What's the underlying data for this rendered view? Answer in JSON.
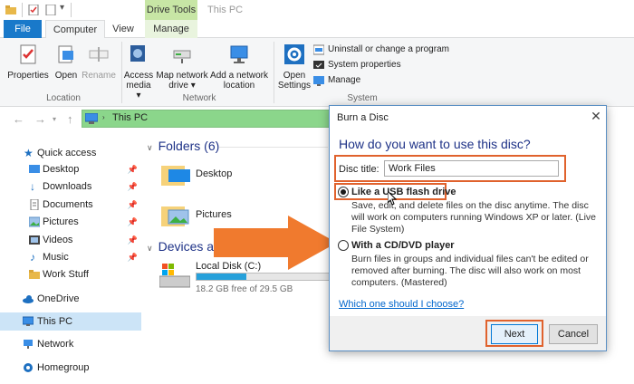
{
  "window": {
    "title": "This PC",
    "context_tab": "Drive Tools"
  },
  "tabs": {
    "file": "File",
    "computer": "Computer",
    "view": "View",
    "manage": "Manage"
  },
  "ribbon": {
    "location": {
      "label": "Location",
      "properties": "Properties",
      "open": "Open",
      "rename": "Rename"
    },
    "network": {
      "label": "Network",
      "access_media": "Access media ▾",
      "map_drive": "Map network drive ▾",
      "add_location": "Add a network location"
    },
    "system": {
      "label": "System",
      "open_settings": "Open Settings",
      "uninstall": "Uninstall or change a program",
      "system_properties": "System properties",
      "manage": "Manage"
    }
  },
  "address": {
    "path": "This PC"
  },
  "nav": {
    "quick_access": "Quick access",
    "desktop": "Desktop",
    "downloads": "Downloads",
    "documents": "Documents",
    "pictures": "Pictures",
    "videos": "Videos",
    "music": "Music",
    "work_stuff": "Work Stuff",
    "onedrive": "OneDrive",
    "this_pc": "This PC",
    "network": "Network",
    "homegroup": "Homegroup"
  },
  "content": {
    "folders_header": "Folders (6)",
    "folders": [
      "Desktop",
      "Pictures"
    ],
    "devices_header": "Devices and",
    "drive": {
      "name": "Local Disk (C:)",
      "free": "18.2 GB free of 29.5 GB",
      "used_fraction": 0.38
    }
  },
  "dialog": {
    "title": "Burn a Disc",
    "close": "✕",
    "question": "How do you want to use this disc?",
    "disc_title_label": "Disc title:",
    "disc_title_value": "Work Files",
    "option1": {
      "title": "Like a USB flash drive",
      "desc": "Save, edit, and delete files on the disc anytime. The disc will work on computers running Windows XP or later. (Live File System)",
      "selected": true
    },
    "option2": {
      "title": "With a CD/DVD player",
      "desc": "Burn files in groups and individual files can't be edited or removed after burning. The disc will also work on most computers. (Mastered)",
      "selected": false
    },
    "help_link": "Which one should I choose?",
    "next": "Next",
    "cancel": "Cancel"
  },
  "colors": {
    "accent": "#1979ca",
    "highlight": "#e0622d",
    "arrow": "#f07a2e",
    "address_green": "#8bd68b"
  }
}
